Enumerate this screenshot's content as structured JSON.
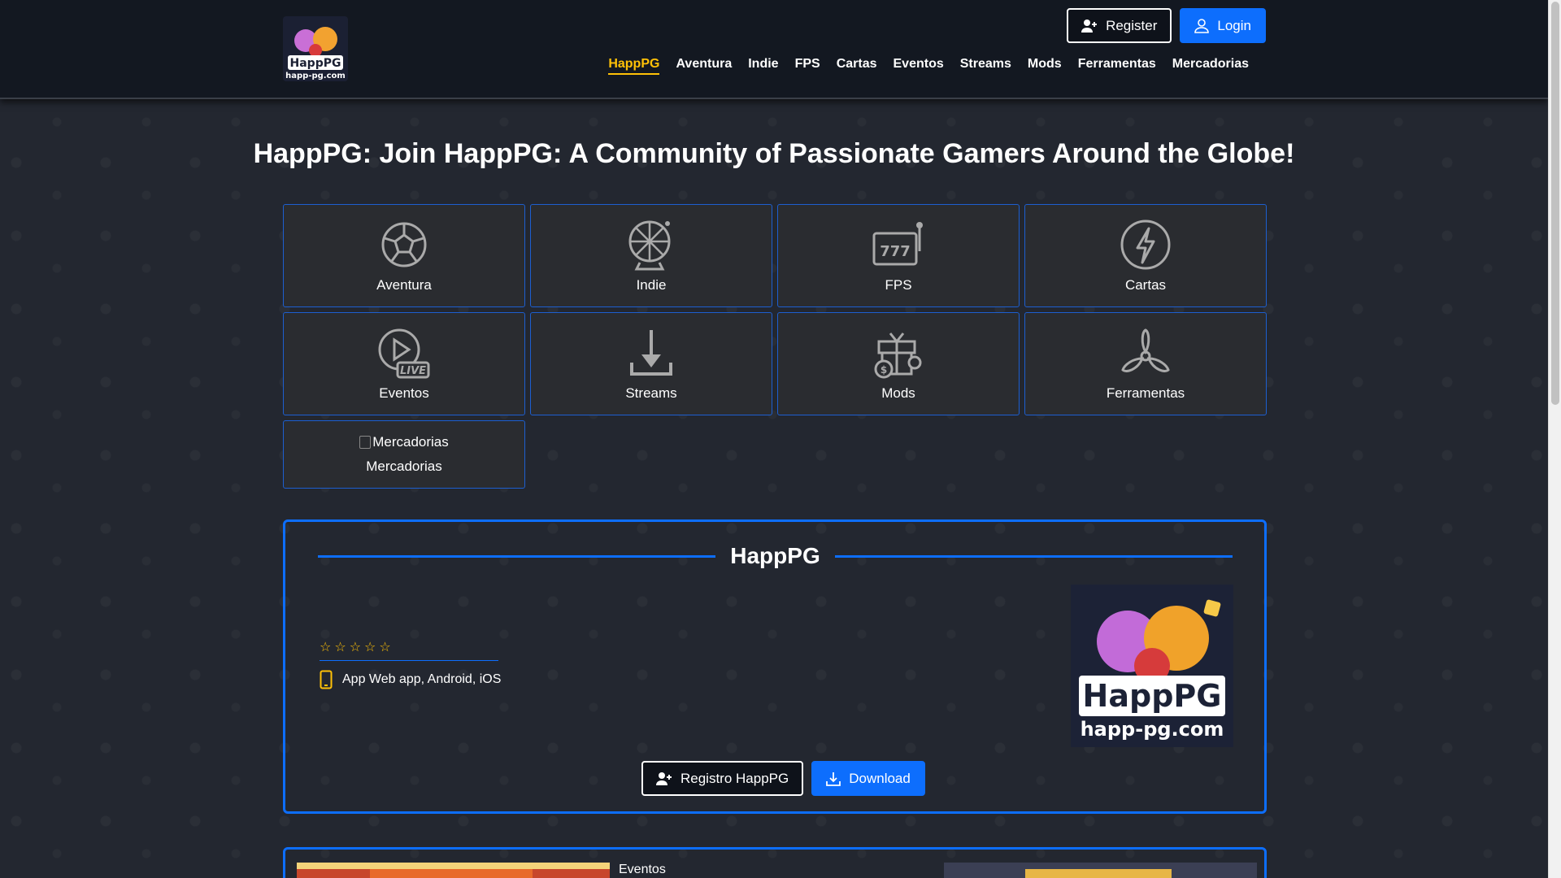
{
  "header": {
    "logo_alt": "HappPG happ-pg.com",
    "register_label": "Register",
    "login_label": "Login",
    "nav": [
      {
        "label": "HappPG",
        "active": true
      },
      {
        "label": "Aventura"
      },
      {
        "label": "Indie"
      },
      {
        "label": "FPS"
      },
      {
        "label": "Cartas"
      },
      {
        "label": "Eventos"
      },
      {
        "label": "Streams"
      },
      {
        "label": "Mods"
      },
      {
        "label": "Ferramentas"
      },
      {
        "label": "Mercadorias"
      }
    ]
  },
  "hero": {
    "title": "HappPG: Join HappPG: A Community of Passionate Gamers Around the Globe!"
  },
  "categories": [
    {
      "label": "Aventura",
      "icon": "soccer-ball-icon"
    },
    {
      "label": "Indie",
      "icon": "roulette-wheel-icon"
    },
    {
      "label": "FPS",
      "icon": "slot-machine-icon"
    },
    {
      "label": "Cartas",
      "icon": "lightning-icon"
    },
    {
      "label": "Eventos",
      "icon": "live-play-icon"
    },
    {
      "label": "Streams",
      "icon": "download-icon"
    },
    {
      "label": "Mods",
      "icon": "gift-coin-icon"
    },
    {
      "label": "Ferramentas",
      "icon": "fan-icon"
    },
    {
      "label": "Mercadorias",
      "icon": "broken-image-icon",
      "img_alt": "Mercadorias"
    }
  ],
  "feature": {
    "title": "HappPG",
    "rating_stars": 5,
    "rating_filled": 0,
    "platform_text": "App Web app, Android, iOS",
    "image_alt": "HappPG happ-pg.com",
    "register_button": "Registro HappPG",
    "download_button": "Download"
  },
  "bottom": {
    "label": "Eventos"
  },
  "colors": {
    "accent": "#0d6efd",
    "active_nav": "#ffc107",
    "header_bg": "#131821",
    "tile_bg": "#2a2c30"
  }
}
